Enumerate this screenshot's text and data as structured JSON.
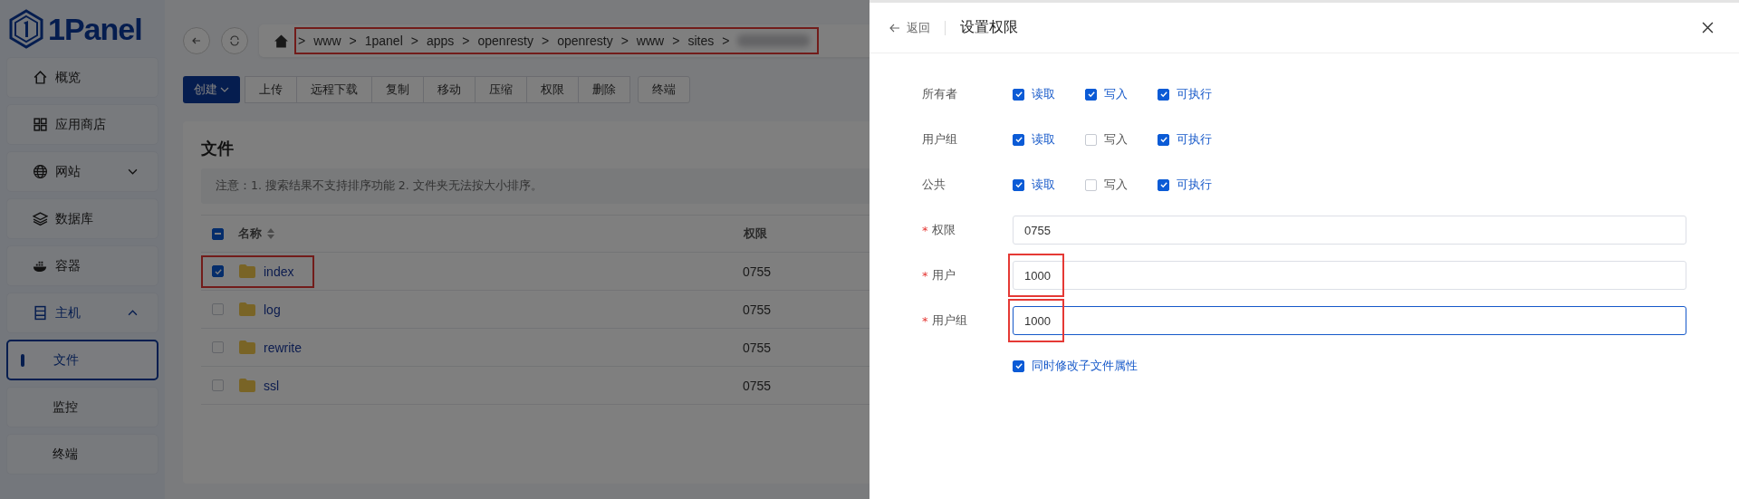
{
  "logo": {
    "text": "1Panel"
  },
  "sidebar": {
    "items": [
      {
        "label": "概览",
        "selected": false
      },
      {
        "label": "应用商店",
        "selected": false
      },
      {
        "label": "网站",
        "selected": false,
        "expanded": false
      },
      {
        "label": "数据库",
        "selected": false
      },
      {
        "label": "容器",
        "selected": false
      },
      {
        "label": "主机",
        "selected": false,
        "expanded": true,
        "children": [
          {
            "label": "文件",
            "selected": true
          },
          {
            "label": "监控",
            "selected": false
          },
          {
            "label": "终端",
            "selected": false
          }
        ]
      }
    ]
  },
  "breadcrumb": {
    "highlighted": true,
    "separator": ">",
    "segments": [
      "www",
      "1panel",
      "apps",
      "openresty",
      "openresty",
      "www",
      "sites"
    ]
  },
  "toolbar": {
    "primary": "创建",
    "buttons": [
      "上传",
      "远程下载",
      "复制",
      "移动",
      "压缩",
      "权限",
      "删除"
    ],
    "extra": "终端"
  },
  "files": {
    "title": "文件",
    "notice": "注意：1. 搜索结果不支持排序功能 2. 文件夹无法按大小排序。",
    "columns": [
      "名称",
      "权限"
    ],
    "header_checkbox": {
      "indeterminate": true
    },
    "rows": [
      {
        "name": "index",
        "permission": "0755",
        "selected": true,
        "highlighted": true
      },
      {
        "name": "log",
        "permission": "0755",
        "selected": false,
        "highlighted": false
      },
      {
        "name": "rewrite",
        "permission": "0755",
        "selected": false,
        "highlighted": false
      },
      {
        "name": "ssl",
        "permission": "0755",
        "selected": false,
        "highlighted": false
      }
    ]
  },
  "drawer": {
    "back": "返回",
    "title": "设置权限",
    "permissions": [
      {
        "label": "所有者",
        "options": [
          {
            "label": "读取",
            "checked": true
          },
          {
            "label": "写入",
            "checked": true
          },
          {
            "label": "可执行",
            "checked": true
          }
        ]
      },
      {
        "label": "用户组",
        "options": [
          {
            "label": "读取",
            "checked": true
          },
          {
            "label": "写入",
            "checked": false
          },
          {
            "label": "可执行",
            "checked": true
          }
        ]
      },
      {
        "label": "公共",
        "options": [
          {
            "label": "读取",
            "checked": true
          },
          {
            "label": "写入",
            "checked": false
          },
          {
            "label": "可执行",
            "checked": true
          }
        ]
      }
    ],
    "fields": [
      {
        "required_mark": "*",
        "label": "权限",
        "value": "0755",
        "focused": false,
        "highlighted": false
      },
      {
        "required_mark": "*",
        "label": "用户",
        "value": "1000",
        "focused": false,
        "highlighted": true
      },
      {
        "required_mark": "*",
        "label": "用户组",
        "value": "1000",
        "focused": true,
        "highlighted": true
      }
    ],
    "sub_files": {
      "label": "同时修改子文件属性",
      "checked": true
    }
  }
}
